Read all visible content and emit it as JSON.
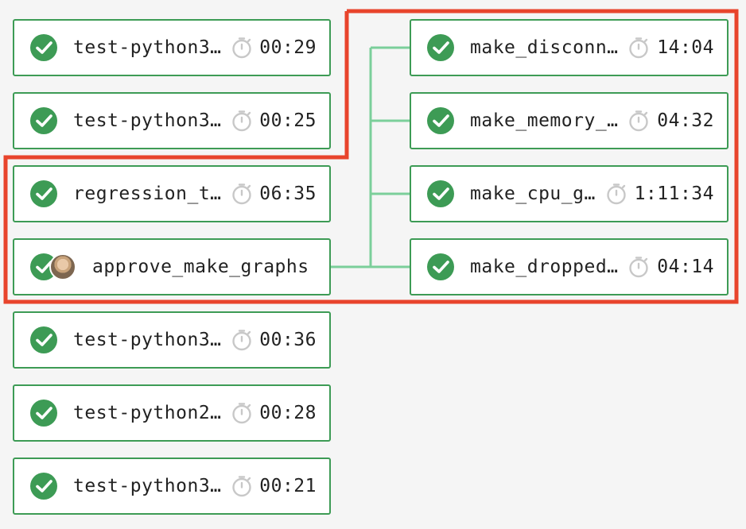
{
  "colors": {
    "success": "#3d9b55",
    "connector": "#7bcf9a",
    "highlight": "#e8442c",
    "timer": "#c8c8c8"
  },
  "left_jobs": [
    {
      "name": "test-python3…",
      "duration": "00:29",
      "status": "success"
    },
    {
      "name": "test-python3…",
      "duration": "00:25",
      "status": "success"
    },
    {
      "name": "regression_t…",
      "duration": "06:35",
      "status": "success"
    }
  ],
  "approval_job": {
    "name": "approve_make_graphs",
    "status": "success",
    "avatar": "user-avatar"
  },
  "bottom_jobs": [
    {
      "name": "test-python3…",
      "duration": "00:36",
      "status": "success"
    },
    {
      "name": "test-python2…",
      "duration": "00:28",
      "status": "success"
    },
    {
      "name": "test-python3…",
      "duration": "00:21",
      "status": "success"
    }
  ],
  "right_jobs": [
    {
      "name": "make_disconn…",
      "duration": "14:04",
      "status": "success"
    },
    {
      "name": "make_memory_…",
      "duration": "04:32",
      "status": "success"
    },
    {
      "name": "make_cpu_g…",
      "duration": "1:11:34",
      "status": "success"
    },
    {
      "name": "make_dropped…",
      "duration": "04:14",
      "status": "success"
    }
  ]
}
